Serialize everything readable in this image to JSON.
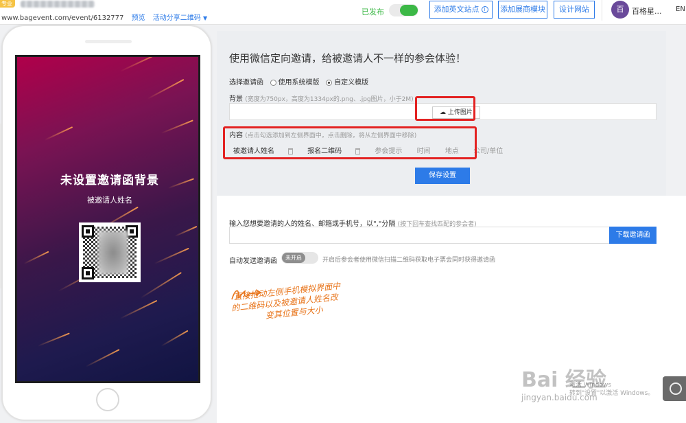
{
  "topbar": {
    "badge": "专业版",
    "url": "www.bagevent.com/event/6132777",
    "preview": "预览",
    "share_qr": "活动分享二维码",
    "caret": "▼",
    "published": "已发布",
    "btn_add_en_site": "添加英文站点",
    "btn_add_en_info": "i",
    "btn_add_exhibitor": "添加展商模块",
    "btn_design_site": "设计网站",
    "avatar_char": "百",
    "username": "百格星...",
    "lang": "EN"
  },
  "phone": {
    "title": "未设置邀请函背景",
    "subtitle": "被邀请人姓名"
  },
  "panel": {
    "title": "使用微信定向邀请，给被邀请人不一样的参会体验！",
    "template_label": "选择邀请函",
    "template_system": "使用系统模版",
    "template_custom": "自定义模版",
    "background_label": "背景",
    "background_hint": "(宽度为750px，高度为1334px的.png、.jpg图片，小于2M)",
    "upload_btn": "上传图片",
    "content_label": "内容",
    "content_hint": "(点击勾选添加到左侧界面中，点击删除，将从左侧界面中移除)",
    "items": {
      "invitee_name": "被邀请人姓名",
      "signup_qr": "报名二维码",
      "tip": "参会提示",
      "time": "时间",
      "place": "地点",
      "company": "公司/单位"
    },
    "save_btn": "保存设置"
  },
  "invite": {
    "label": "输入您想要邀请的人的姓名、邮箱或手机号，以\",\"分隔",
    "label_hint": "(按下回车查找匹配的参会者)",
    "input_value": "",
    "download_btn": "下载邀请函",
    "auto_label": "自动发送邀请函",
    "auto_state": "未开启",
    "auto_hint": "开启后参会者使用微信扫描二维码获取电子票会同时获得邀请函"
  },
  "annotation": {
    "line1": "直接拖动左侧手机模拟界面中",
    "line2": "的二维码以及被邀请人姓名改",
    "line3": "变其位置与大小"
  },
  "watermark": {
    "brand": "Bai 经验",
    "site": "jingyan.baidu.com",
    "activate1": "激活 Windows",
    "activate2": "转到\"设置\"以激活 Windows。"
  },
  "colors": {
    "accent": "#2d7be8",
    "success": "#3cb846",
    "highlight": "#e32222",
    "annotation": "#e8741a"
  }
}
